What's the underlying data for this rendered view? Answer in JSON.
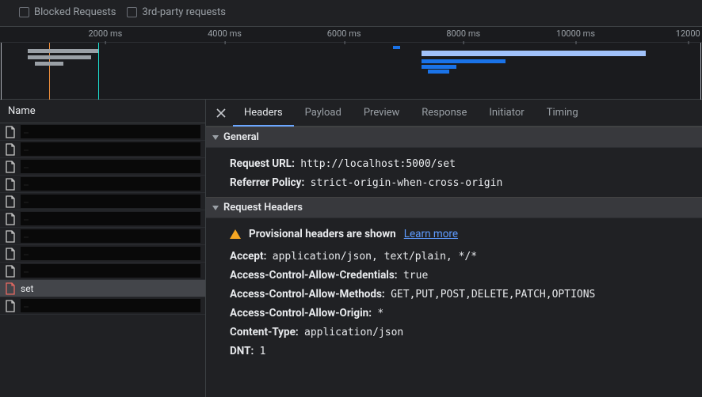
{
  "filters": {
    "blocked_requests": "Blocked Requests",
    "third_party": "3rd-party requests"
  },
  "timeline": {
    "ticks": [
      {
        "label": "2000 ms",
        "pct": 15
      },
      {
        "label": "4000 ms",
        "pct": 32
      },
      {
        "label": "6000 ms",
        "pct": 49
      },
      {
        "label": "8000 ms",
        "pct": 66
      },
      {
        "label": "10000 ms",
        "pct": 82
      },
      {
        "label": "12000",
        "pct": 98
      }
    ]
  },
  "name_col": {
    "header": "Name"
  },
  "requests": {
    "items": [
      {
        "label": "",
        "redacted": true,
        "icon": "grey"
      },
      {
        "label": "",
        "redacted": true,
        "icon": "grey"
      },
      {
        "label": "",
        "redacted": true,
        "icon": "grey"
      },
      {
        "label": "",
        "redacted": true,
        "icon": "grey"
      },
      {
        "label": "",
        "redacted": true,
        "icon": "grey"
      },
      {
        "label": "",
        "redacted": true,
        "icon": "grey"
      },
      {
        "label": "",
        "redacted": true,
        "icon": "grey"
      },
      {
        "label": "",
        "redacted": true,
        "icon": "grey"
      },
      {
        "label": "",
        "redacted": true,
        "icon": "grey"
      },
      {
        "label": "set",
        "redacted": false,
        "selected": true,
        "icon": "red"
      },
      {
        "label": "",
        "redacted": true,
        "icon": "grey"
      }
    ]
  },
  "detail": {
    "tabs": {
      "headers": "Headers",
      "payload": "Payload",
      "preview": "Preview",
      "response": "Response",
      "initiator": "Initiator",
      "timing": "Timing"
    },
    "sections": {
      "general": {
        "title": "General",
        "request_url_k": "Request URL:",
        "request_url_v": "http://localhost:5000/set",
        "referrer_policy_k": "Referrer Policy:",
        "referrer_policy_v": "strict-origin-when-cross-origin"
      },
      "req_headers": {
        "title": "Request Headers",
        "provisional": "Provisional headers are shown",
        "learn_more": "Learn more",
        "rows": [
          {
            "k": "Accept:",
            "v": "application/json, text/plain, */*"
          },
          {
            "k": "Access-Control-Allow-Credentials:",
            "v": "true"
          },
          {
            "k": "Access-Control-Allow-Methods:",
            "v": "GET,PUT,POST,DELETE,PATCH,OPTIONS"
          },
          {
            "k": "Access-Control-Allow-Origin:",
            "v": "*"
          },
          {
            "k": "Content-Type:",
            "v": "application/json"
          },
          {
            "k": "DNT:",
            "v": "1"
          }
        ]
      }
    }
  }
}
